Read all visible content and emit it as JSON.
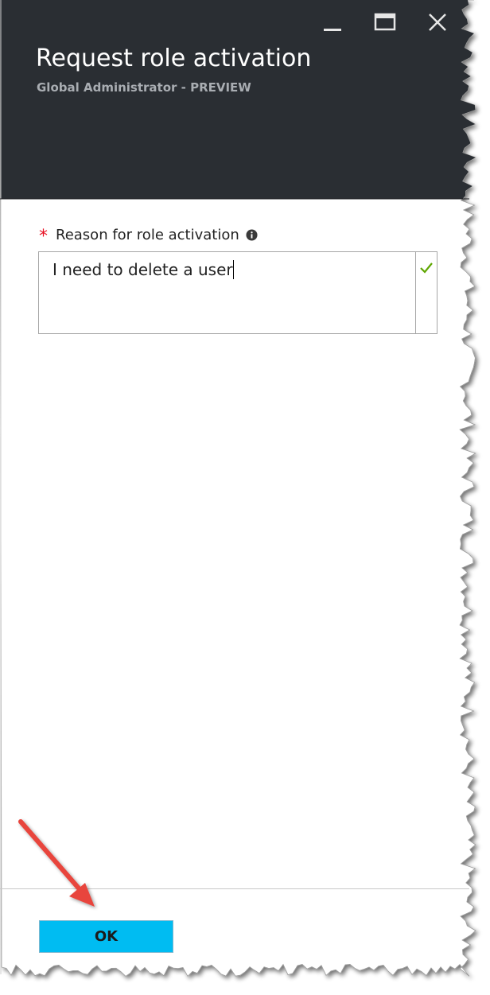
{
  "window": {
    "minimize_icon": "minimize-icon",
    "maximize_icon": "maximize-icon",
    "close_icon": "close-icon"
  },
  "header": {
    "title": "Request role activation",
    "subtitle": "Global Administrator - PREVIEW",
    "background_color": "#2a2e33"
  },
  "form": {
    "required_marker": "*",
    "reason_label": "Reason for role activation",
    "info_icon": "info-icon",
    "reason_value": "I need to delete a user",
    "validation_icon": "checkmark-icon",
    "validation_color": "#5ea600"
  },
  "footer": {
    "ok_label": "OK",
    "ok_color": "#00bcf2"
  },
  "annotation": {
    "arrow_color": "#e8453c"
  }
}
